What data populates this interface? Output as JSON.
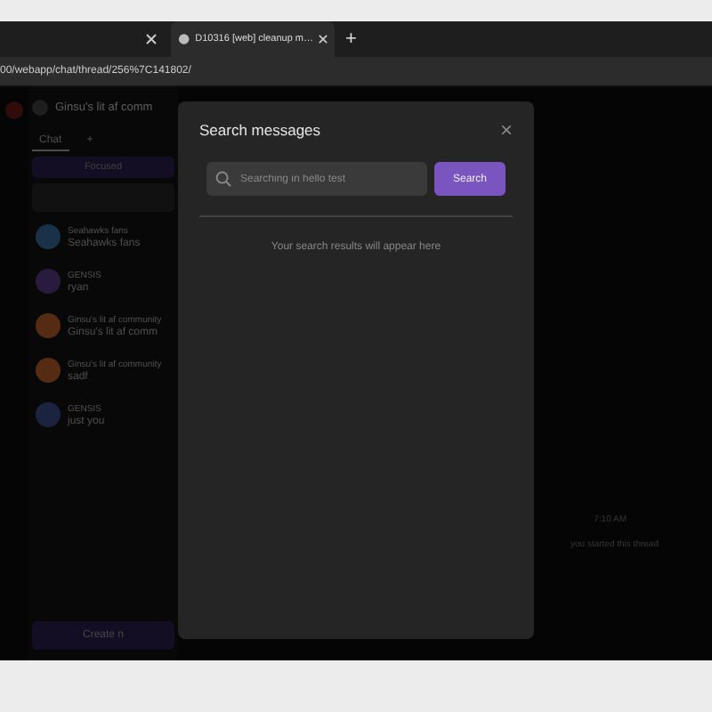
{
  "browser": {
    "tabs": [
      {
        "selected": false
      },
      {
        "title": "D10316 [web] cleanup m…",
        "selected": true
      }
    ],
    "new_tab": "+",
    "url": "00/webapp/chat/thread/256%7C141802/"
  },
  "sidebar": {
    "channel_title": "Ginsu's lit af comm",
    "tabs": [
      {
        "label": "Chat",
        "selected": true
      },
      {
        "label": "+",
        "selected": false
      }
    ],
    "filter": "Focused",
    "chats": [
      {
        "group": "Seahawks fans",
        "name": "Seahawks fans",
        "color": "#1a314a"
      },
      {
        "group": "GENSIS",
        "name": "ryan",
        "color": "#281b3e"
      },
      {
        "group": "Ginsu's lit af community",
        "name": "Ginsu's lit af comm",
        "color": "#562b13"
      },
      {
        "group": "Ginsu's lit af community",
        "name": "sadf",
        "color": "#562b13"
      },
      {
        "group": "GENSIS",
        "name": "just you",
        "color": "#1b233e"
      }
    ],
    "create_button": "Create n"
  },
  "thread": {
    "time": "7:10 AM",
    "note": "you started this thread"
  },
  "modal": {
    "title": "Search messages",
    "close": "×",
    "search": {
      "placeholder": "Searching in hello test"
    },
    "search_button": "Search",
    "empty_text": "Your search results will appear here"
  }
}
